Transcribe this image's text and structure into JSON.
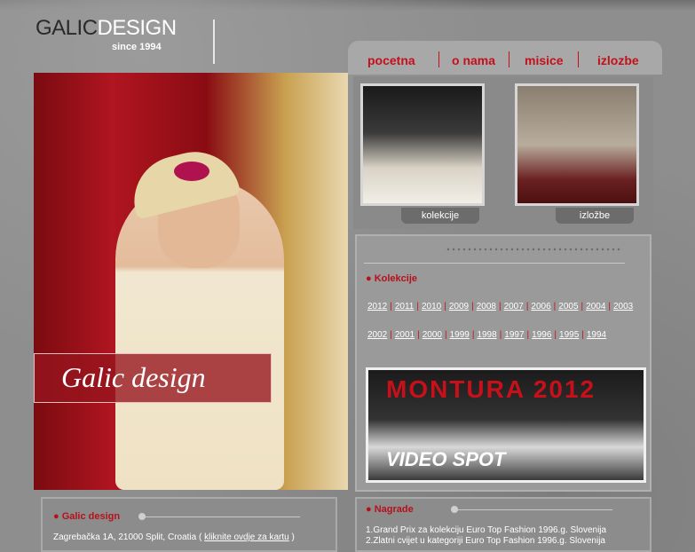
{
  "header": {
    "logo_text_dark": "GALIC",
    "logo_text_light": "DESIGN",
    "since": "since 1994"
  },
  "nav": {
    "items": [
      "pocetna",
      "o nama",
      "misice",
      "izlozbe"
    ]
  },
  "hero": {
    "banner_text": "Galic design"
  },
  "thumbnails": [
    {
      "label": "kolekcije"
    },
    {
      "label": "izložbe"
    }
  ],
  "collections": {
    "title": "Kolekcije",
    "row1": [
      "2012",
      "2011",
      "2010",
      "2009",
      "2008",
      "2007",
      "2006",
      "2005",
      "2004",
      "2003"
    ],
    "row2": [
      "2002",
      "2001",
      "2000",
      "1999",
      "1998",
      "1997",
      "1996",
      "1995",
      "1994"
    ]
  },
  "video": {
    "title": "MONTURA 2012",
    "subtitle": "VIDEO SPOT"
  },
  "contact": {
    "title": "Galic design",
    "address": "Zagrebačka 1A, 21000 Split, Croatia (",
    "map_link": "kliknite ovdje za kartu",
    "address_end": ")"
  },
  "awards": {
    "title": "Nagrade",
    "items": [
      "1.Grand Prix za kolekciju Euro Top Fashion 1996.g. Slovenija",
      "2.Zlatni cvijet u kategoriji Euro Top Fashion 1996.g. Slovenija"
    ]
  },
  "colors": {
    "accent_red": "#c4101a",
    "background": "#8a8a8a"
  }
}
